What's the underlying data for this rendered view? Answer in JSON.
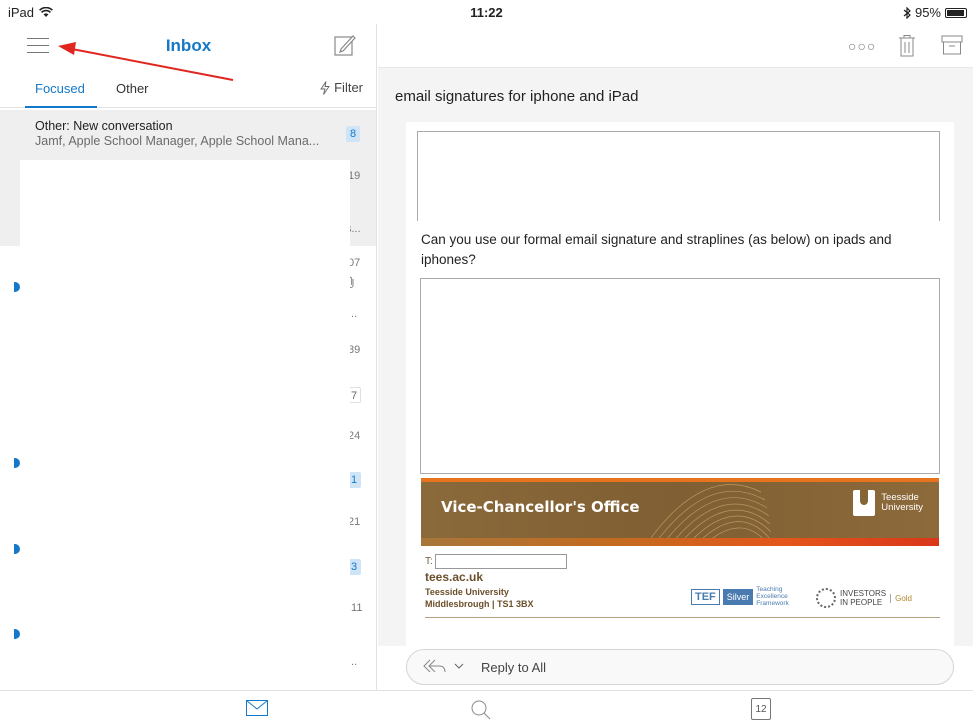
{
  "status_bar": {
    "device": "iPad",
    "time": "11:22",
    "battery": "95%",
    "battery_level": 0.95
  },
  "inbox": {
    "title": "Inbox",
    "tabs": {
      "focused": "Focused",
      "other": "Other"
    },
    "filter_label": "Filter",
    "first_row": {
      "sender": "Other: New conversation",
      "preview": "Jamf, Apple School Manager, Apple School Mana...",
      "count": "8"
    },
    "strip": {
      "t1": "19",
      "t2": "s...",
      "t3": "07",
      "t4": "...",
      "t5": "39",
      "c1": "7",
      "t6": "24",
      "c2": "1",
      "t7": "21",
      "c3": "3",
      "t8": ":11",
      "t9": "..."
    }
  },
  "message": {
    "subject": "email signatures for iphone and iPad",
    "body": "Can you use our formal email signature and straplines (as below) on ipads and iphones?",
    "signature": {
      "office": "Vice-Chancellor's Office",
      "logo_line1": "Teesside",
      "logo_line2": "University",
      "phone_label": "T:",
      "website": "tees.ac.uk",
      "address_line1": "Teesside University",
      "address_line2": "Middlesbrough | TS1 3BX",
      "tef": "TEF",
      "tef_level": "Silver",
      "tef_text1": "Teaching",
      "tef_text2": "Excellence",
      "tef_text3": "Framework",
      "iip_line1": "INVESTORS",
      "iip_line2": "IN PEOPLE",
      "iip_level": "Gold"
    },
    "reply_label": "Reply to All"
  },
  "tabbar": {
    "calendar_day": "12"
  },
  "colors": {
    "accent": "#1479c9",
    "annotation": "#e0261f"
  }
}
